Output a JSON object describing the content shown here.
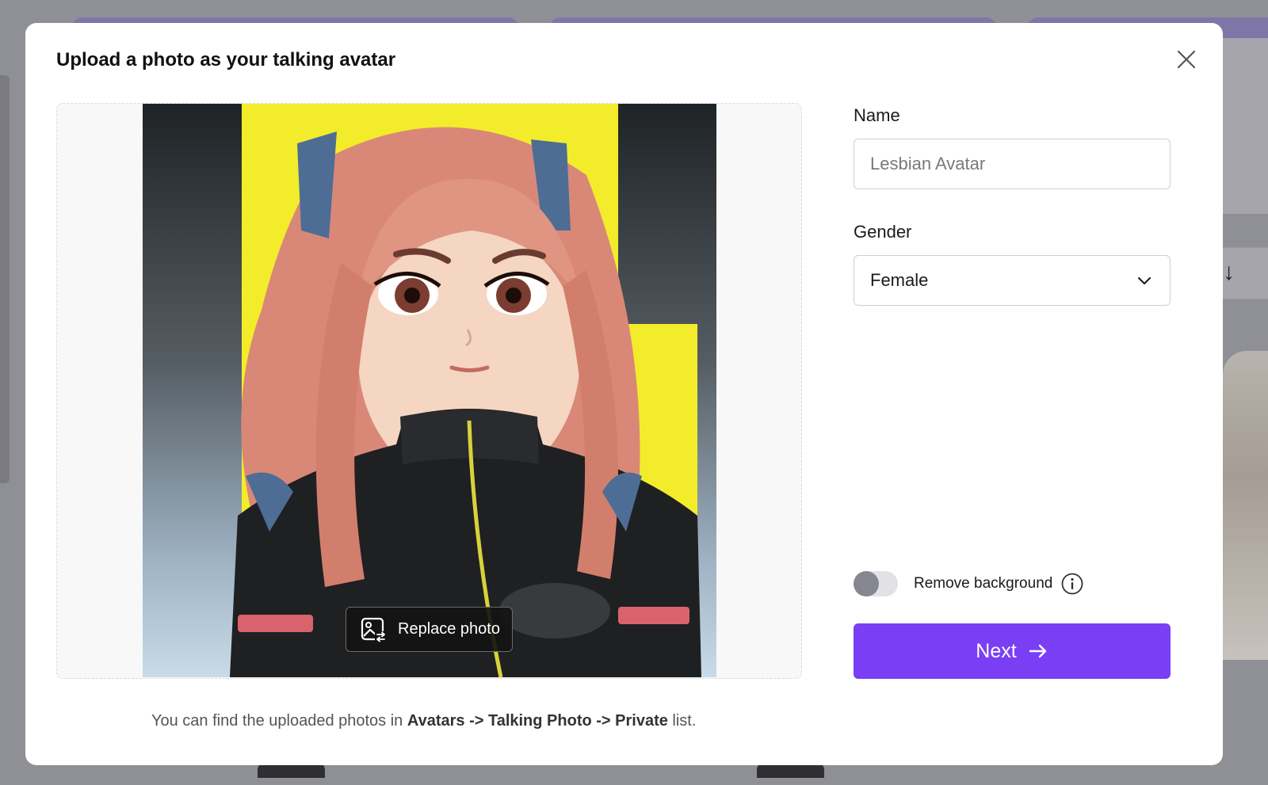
{
  "modal": {
    "title": "Upload a photo as your talking avatar",
    "close_icon": "close-icon"
  },
  "upload": {
    "replace_label": "Replace photo",
    "replace_icon": "image-replace-icon"
  },
  "note": {
    "prefix": "You can find the uploaded photos in ",
    "path": "Avatars -> Talking Photo -> Private",
    "suffix": " list."
  },
  "form": {
    "name_label": "Name",
    "name_value": "",
    "name_placeholder": "Lesbian Avatar",
    "gender_label": "Gender",
    "gender_value": "Female",
    "gender_icon": "chevron-down-icon",
    "remove_bg_label": "Remove background",
    "remove_bg_on": false,
    "info_icon": "info-icon",
    "next_label": "Next",
    "next_icon": "arrow-right-icon"
  },
  "colors": {
    "accent": "#7a3ff5",
    "overlay": "#8f8f96",
    "toggle_knob": "#868690"
  }
}
